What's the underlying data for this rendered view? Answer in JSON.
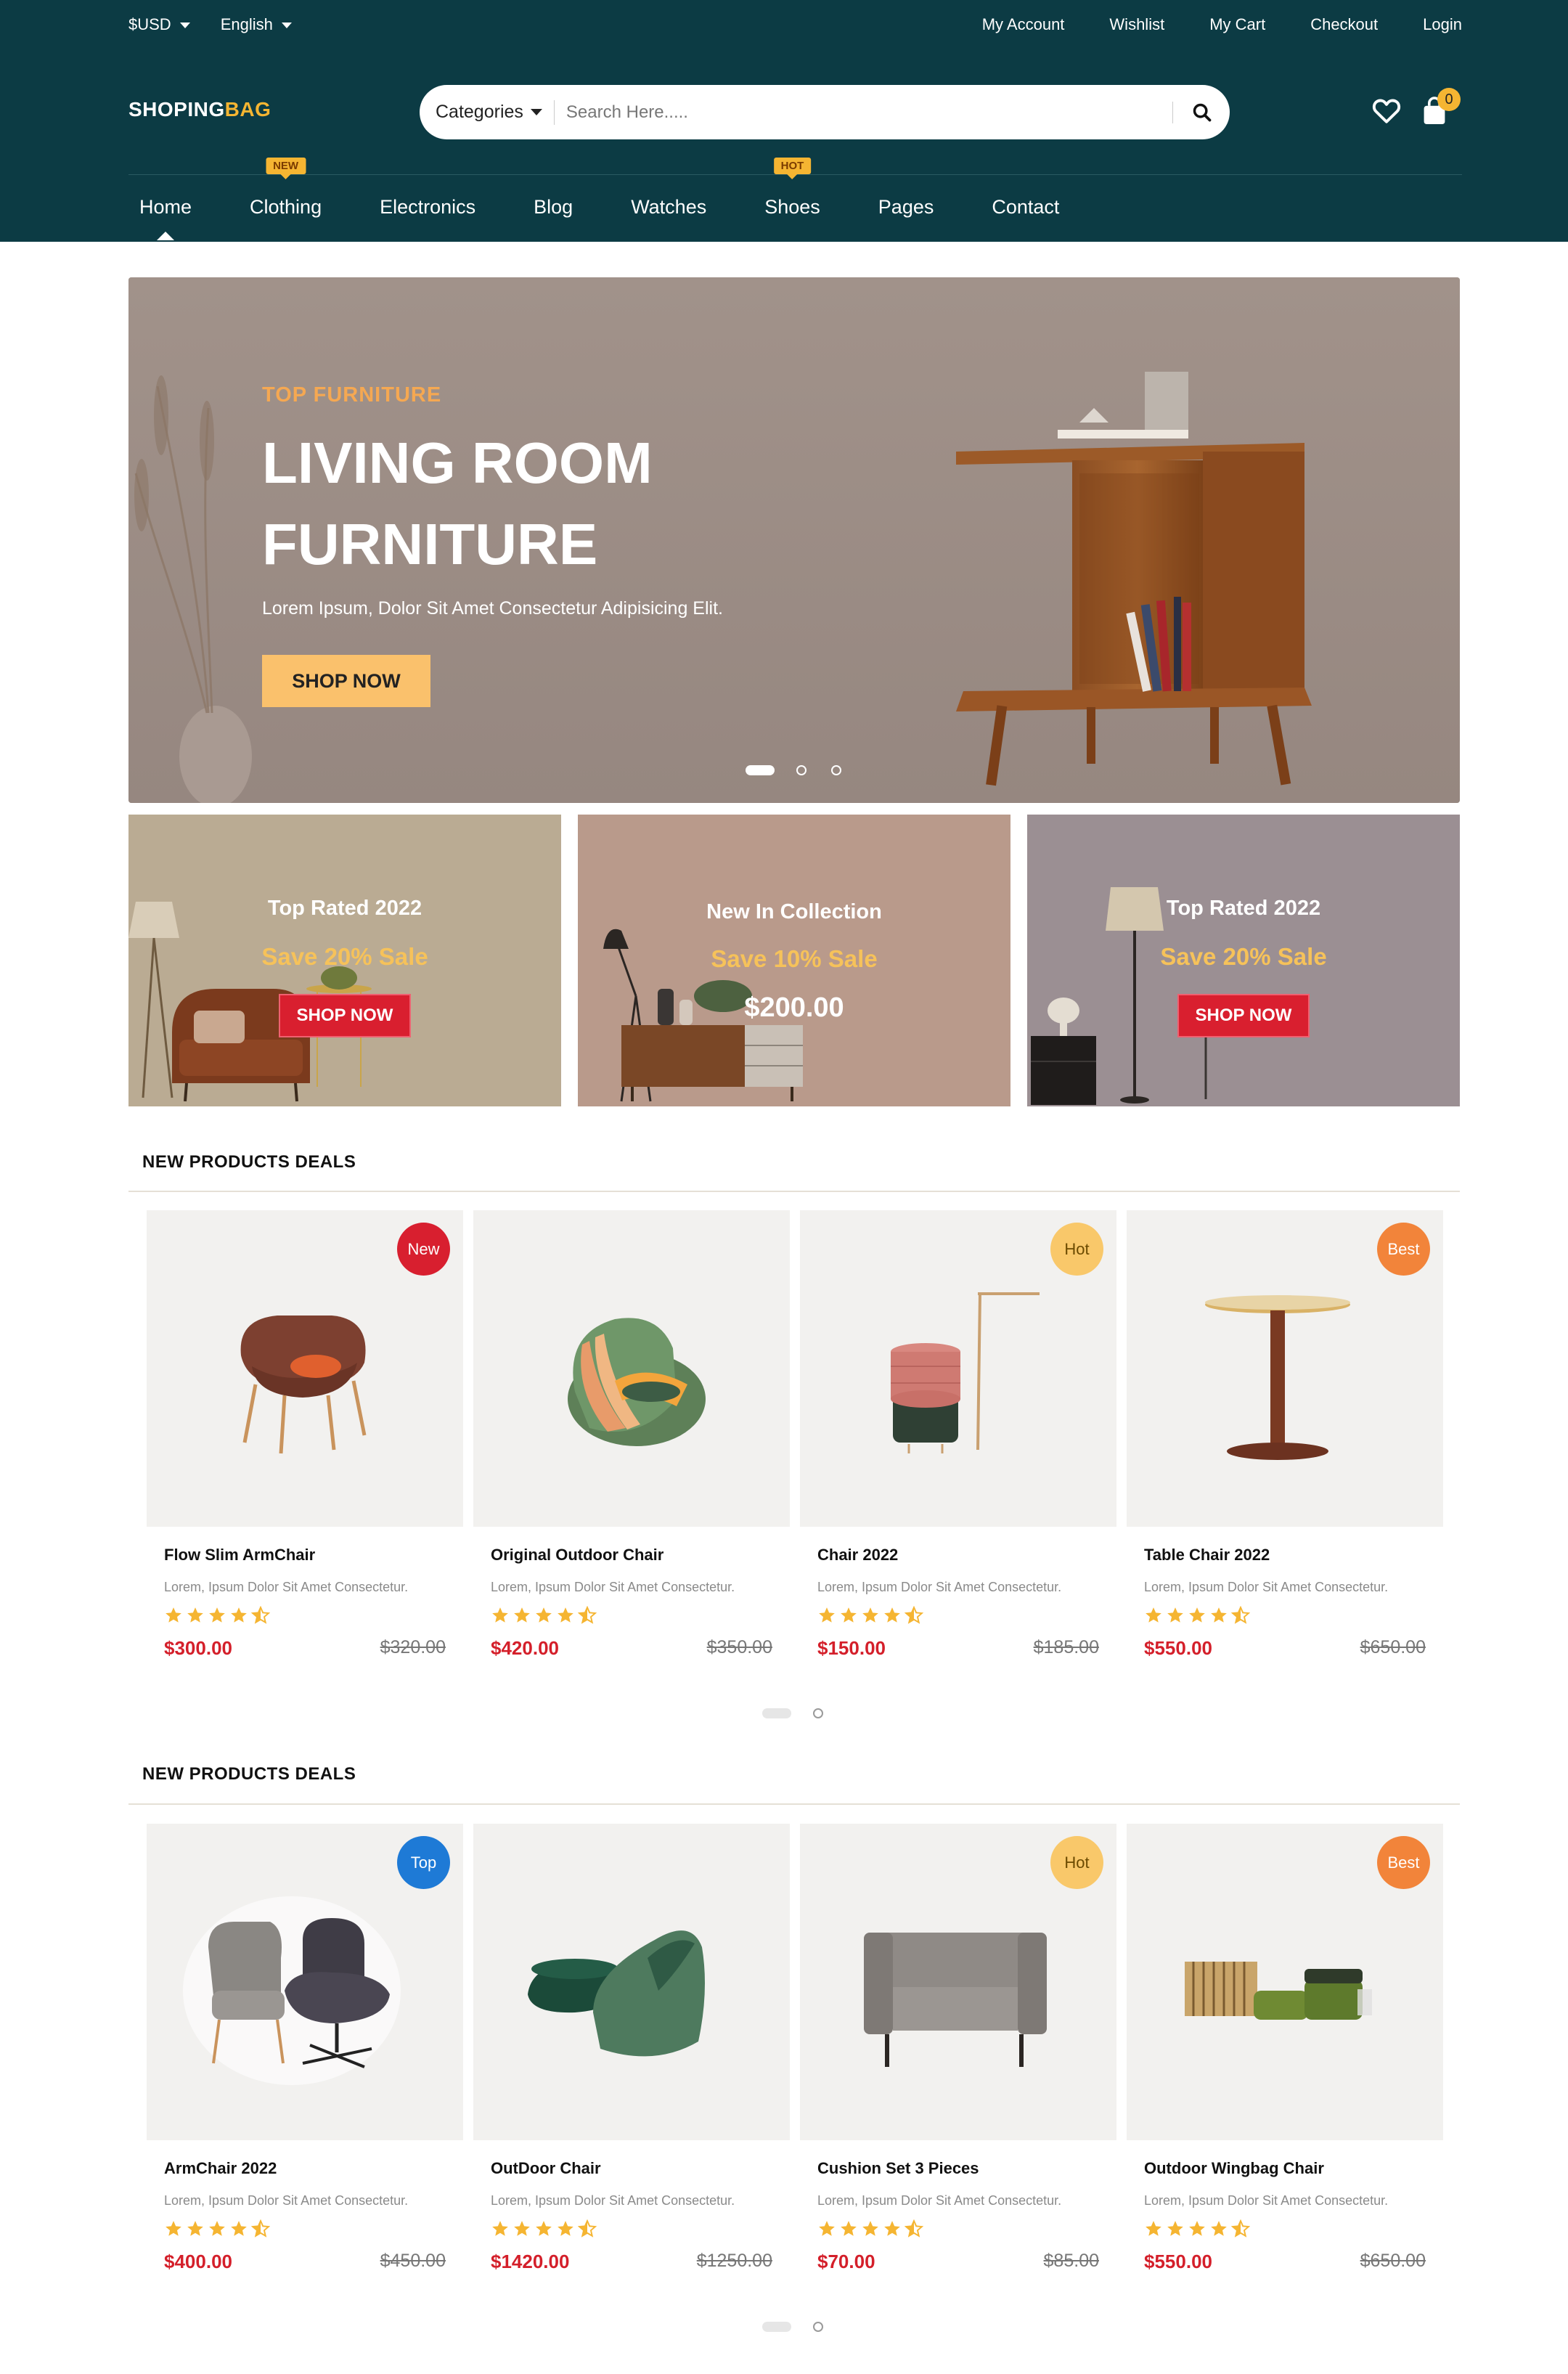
{
  "topbar": {
    "currency": "$USD",
    "language": "English",
    "links": [
      "My Account",
      "Wishlist",
      "My Cart",
      "Checkout",
      "Login"
    ]
  },
  "logo": {
    "part1": "SHOPING",
    "part2": "BAG"
  },
  "search": {
    "category_label": "Categories",
    "placeholder": "Search Here....."
  },
  "cart": {
    "count": "0"
  },
  "nav": {
    "items": [
      "Home",
      "Clothing",
      "Electronics",
      "Blog",
      "Watches",
      "Shoes",
      "Pages",
      "Contact"
    ],
    "tags": {
      "clothing": "NEW",
      "shoes": "HOT"
    }
  },
  "hero": {
    "pretitle": "TOP FURNITURE",
    "title_line1": "LIVING ROOM",
    "title_line2": "FURNITURE",
    "description": "Lorem Ipsum, Dolor Sit Amet Consectetur Adipisicing Elit.",
    "button": "SHOP NOW"
  },
  "banners": [
    {
      "title": "Top Rated 2022",
      "sale": "Save 20% Sale",
      "button": "SHOP NOW"
    },
    {
      "title": "New In Collection",
      "sale": "Save 10% Sale",
      "price": "$200.00"
    },
    {
      "title": "Top Rated 2022",
      "sale": "Save 20% Sale",
      "button": "SHOP NOW"
    }
  ],
  "sections": [
    {
      "title": "NEW PRODUCTS DEALS",
      "products": [
        {
          "name": "Flow Slim ArmChair",
          "desc": "Lorem, Ipsum Dolor Sit Amet Consectetur.",
          "price": "$300.00",
          "old_price": "$320.00",
          "badge": "New",
          "rating": 4.5
        },
        {
          "name": "Original Outdoor Chair",
          "desc": "Lorem, Ipsum Dolor Sit Amet Consectetur.",
          "price": "$420.00",
          "old_price": "$350.00",
          "badge": "",
          "rating": 4.5
        },
        {
          "name": "Chair 2022",
          "desc": "Lorem, Ipsum Dolor Sit Amet Consectetur.",
          "price": "$150.00",
          "old_price": "$185.00",
          "badge": "Hot",
          "rating": 4.5
        },
        {
          "name": "Table Chair 2022",
          "desc": "Lorem, Ipsum Dolor Sit Amet Consectetur.",
          "price": "$550.00",
          "old_price": "$650.00",
          "badge": "Best",
          "rating": 4.5
        }
      ]
    },
    {
      "title": "NEW PRODUCTS DEALS",
      "products": [
        {
          "name": "ArmChair 2022",
          "desc": "Lorem, Ipsum Dolor Sit Amet Consectetur.",
          "price": "$400.00",
          "old_price": "$450.00",
          "badge": "Top",
          "rating": 4.5
        },
        {
          "name": "OutDoor Chair",
          "desc": "Lorem, Ipsum Dolor Sit Amet Consectetur.",
          "price": "$1420.00",
          "old_price": "$1250.00",
          "badge": "",
          "rating": 4.5
        },
        {
          "name": "Cushion Set 3 Pieces",
          "desc": "Lorem, Ipsum Dolor Sit Amet Consectetur.",
          "price": "$70.00",
          "old_price": "$85.00",
          "badge": "Hot",
          "rating": 4.5
        },
        {
          "name": "Outdoor Wingbag Chair",
          "desc": "Lorem, Ipsum Dolor Sit Amet Consectetur.",
          "price": "$550.00",
          "old_price": "$650.00",
          "badge": "Best",
          "rating": 4.5
        }
      ]
    }
  ],
  "colors": {
    "header_bg": "#0c3b44",
    "accent_yellow": "#f5b532",
    "price_red": "#d41f2a",
    "badge_new": "#d81f2f",
    "badge_hot": "#f9c86a",
    "badge_best": "#f2843a",
    "badge_top": "#1e7ad6"
  },
  "icons": [
    "caret-down-icon",
    "search-icon",
    "heart-icon",
    "shopping-bag-icon",
    "star-icon",
    "half-star-icon"
  ]
}
